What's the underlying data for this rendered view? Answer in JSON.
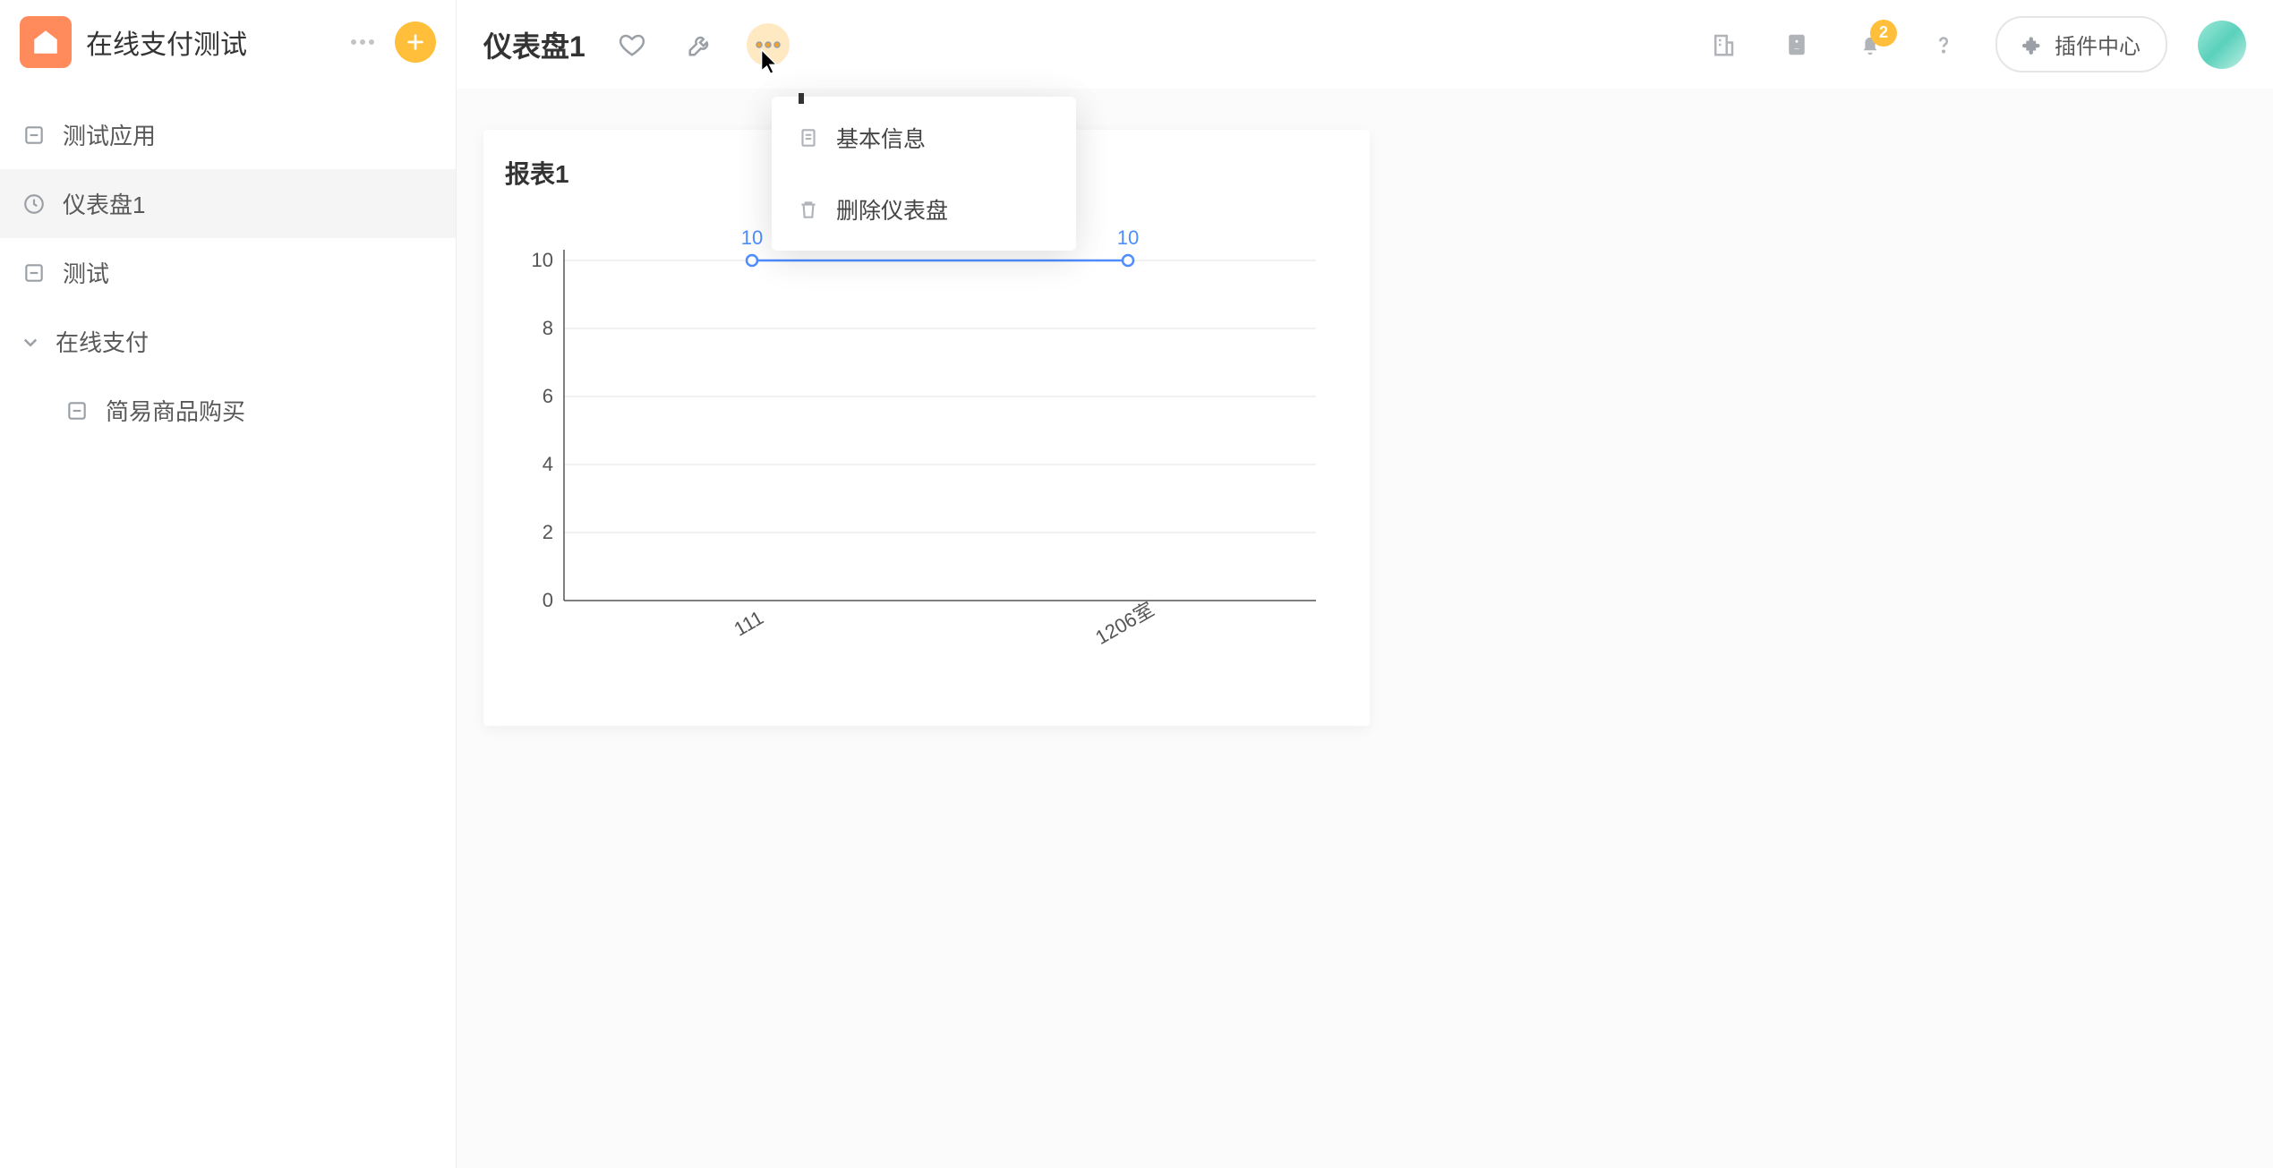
{
  "sidebar": {
    "app_title": "在线支付测试",
    "items": [
      {
        "icon": "form",
        "label": "测试应用"
      },
      {
        "icon": "clock",
        "label": "仪表盘1",
        "active": true
      },
      {
        "icon": "form",
        "label": "测试"
      },
      {
        "icon": "caret",
        "label": "在线支付"
      },
      {
        "icon": "form",
        "label": "简易商品购买",
        "indent": true
      }
    ]
  },
  "topbar": {
    "page_title": "仪表盘1",
    "notification_count": "2",
    "plugin_center_label": "插件中心"
  },
  "dropdown": {
    "items": [
      {
        "icon": "doc",
        "label": "基本信息"
      },
      {
        "icon": "trash",
        "label": "删除仪表盘"
      }
    ]
  },
  "card": {
    "title": "报表1"
  },
  "chart_data": {
    "type": "line",
    "categories": [
      "111",
      "1206室"
    ],
    "values": [
      10,
      10
    ],
    "xlabel": "",
    "ylabel": "",
    "ylim": [
      0,
      10
    ],
    "y_ticks": [
      0,
      2,
      4,
      6,
      8,
      10
    ],
    "data_labels": [
      "10",
      "10"
    ],
    "series_color": "#4f8dff"
  }
}
